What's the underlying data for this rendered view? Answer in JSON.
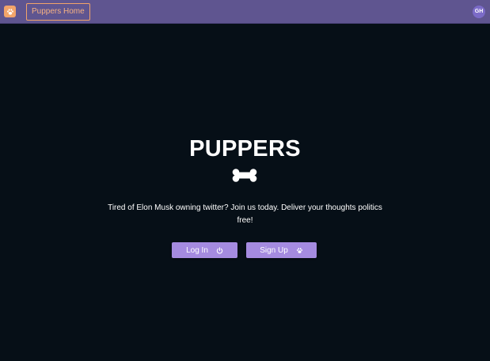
{
  "navbar": {
    "logo_icon": "paw-icon",
    "home_label": "Puppers Home",
    "avatar_initials": "GH"
  },
  "hero": {
    "title": "PUPPERS",
    "divider_icon": "bone-icon",
    "tagline": "Tired of Elon Musk owning twitter? Join us today. Deliver your thoughts politics free!"
  },
  "actions": {
    "login_label": "Log In",
    "login_icon": "power-icon",
    "signup_label": "Sign Up",
    "signup_icon": "paw-icon"
  },
  "colors": {
    "navbar": "#5f5590",
    "background": "#060f17",
    "accent": "#f2a46a",
    "button": "#a58be0",
    "avatar": "#7b6bc8"
  }
}
